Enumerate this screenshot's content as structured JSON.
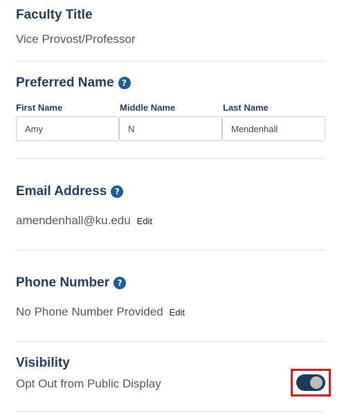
{
  "faculty_title": {
    "heading": "Faculty Title",
    "value": "Vice Provost/Professor"
  },
  "preferred_name": {
    "heading": "Preferred Name",
    "help_glyph": "?",
    "first": {
      "label": "First Name",
      "value": "Amy"
    },
    "middle": {
      "label": "Middle Name",
      "value": "N"
    },
    "last": {
      "label": "Last Name",
      "value": "Mendenhall"
    }
  },
  "email": {
    "heading": "Email Address",
    "help_glyph": "?",
    "value": "amendenhall@ku.edu",
    "edit_label": "Edit"
  },
  "phone": {
    "heading": "Phone Number",
    "help_glyph": "?",
    "value": "No Phone Number Provided",
    "edit_label": "Edit"
  },
  "visibility": {
    "heading": "Visibility",
    "label": "Opt Out from Public Display",
    "toggle_on": true
  },
  "colors": {
    "heading": "#1f3a5f",
    "help_icon": "#1f5d93",
    "toggle_track": "#1d3a59",
    "highlight_box": "#d7191f"
  }
}
